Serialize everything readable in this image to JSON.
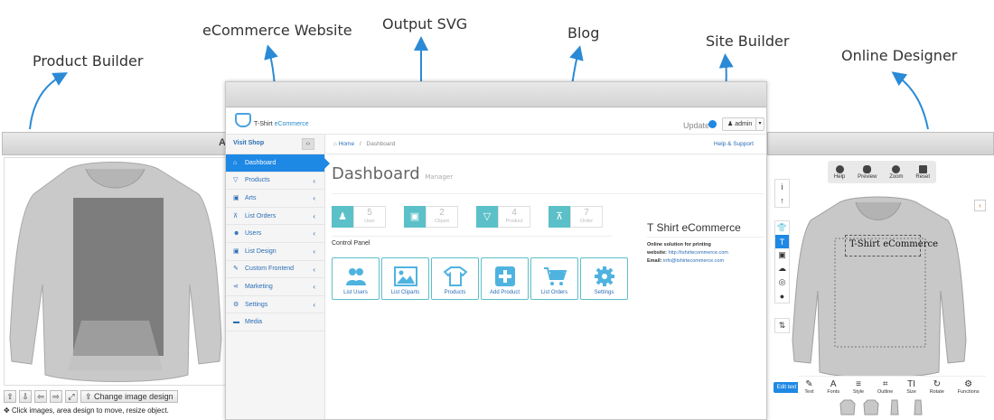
{
  "callouts": {
    "product_builder": "Product Builder",
    "ecommerce_website": "eCommerce Website",
    "output_svg": "Output SVG",
    "blog": "Blog",
    "site_builder": "Site Builder",
    "online_designer": "Online Designer"
  },
  "product_builder": {
    "bar_text": "A",
    "change_image_label": "Change image design",
    "hint": "Click images, area design to move, resize object."
  },
  "header": {
    "logo_text_a": "T-Shirt ",
    "logo_text_b": "eCommerce",
    "update_label": "Update",
    "user_label": "admin"
  },
  "sidebar": {
    "visit_shop": "Visit Shop",
    "items": [
      {
        "label": "Dashboard",
        "icon": "home-icon"
      },
      {
        "label": "Products",
        "icon": "shirt-icon"
      },
      {
        "label": "Arts",
        "icon": "image-icon"
      },
      {
        "label": "List Orders",
        "icon": "cart-icon"
      },
      {
        "label": "Users",
        "icon": "users-icon"
      },
      {
        "label": "List Design",
        "icon": "image-icon"
      },
      {
        "label": "Custom Frontend",
        "icon": "pencil-icon"
      },
      {
        "label": "Marketing",
        "icon": "share-icon"
      },
      {
        "label": "Settings",
        "icon": "gear-icon"
      },
      {
        "label": "Media",
        "icon": "folder-icon"
      }
    ]
  },
  "breadcrumb": {
    "home": "Home",
    "current": "Dashboard",
    "help": "Help & Support"
  },
  "dashboard": {
    "title": "Dashboard",
    "subtitle": "Manager",
    "stats": [
      {
        "value": "5",
        "label": "User"
      },
      {
        "value": "2",
        "label": "Clipart"
      },
      {
        "value": "4",
        "label": "Product"
      },
      {
        "value": "7",
        "label": "Order"
      }
    ],
    "control_panel_label": "Control Panel",
    "tiles": [
      {
        "label": "List Users"
      },
      {
        "label": "List Cliparts"
      },
      {
        "label": "Products"
      },
      {
        "label": "Add Product"
      },
      {
        "label": "List Orders"
      },
      {
        "label": "Settings"
      }
    ]
  },
  "info": {
    "title": "T Shirt eCommerce",
    "line1": "Online solution for printing",
    "website_label": "website:",
    "website_value": "http://tshirtecommerce.com",
    "email_label": "Email:",
    "email_value": "info@tshirtecommerce.com"
  },
  "designer": {
    "top_tools": [
      "Help",
      "Preview",
      "Zoom",
      "Reset"
    ],
    "design_text": "T-Shirt eCommerce",
    "edit_text_button": "Edit text",
    "bottom_tools": [
      "Text",
      "Fonts",
      "Style",
      "Outline",
      "Size",
      "Rotate",
      "Functions"
    ],
    "bottom_icons": [
      "✎",
      "A",
      "≡",
      "⌗",
      "TI",
      "↻",
      "⚙"
    ]
  },
  "colors": {
    "accent": "#1e88e5",
    "teal": "#5bc0c8",
    "link": "#2a6db5"
  }
}
